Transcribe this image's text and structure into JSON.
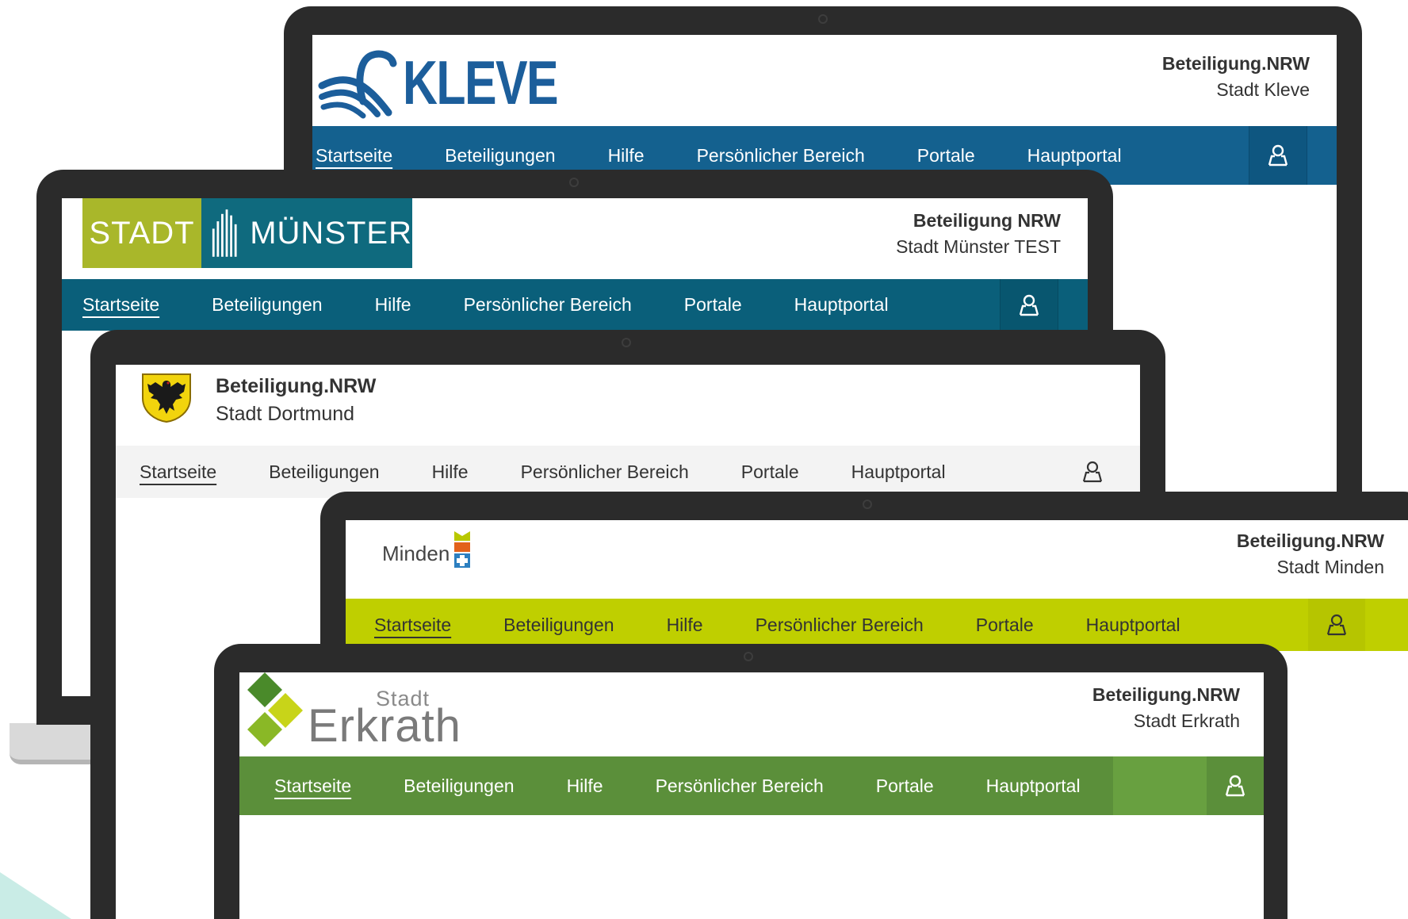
{
  "devices": [
    {
      "id": "kleve",
      "brand_title": "Beteiligung.NRW",
      "brand_subtitle": "Stadt Kleve",
      "logo_text": "KLEVE",
      "nav": [
        "Startseite",
        "Beteiligungen",
        "Hilfe",
        "Persönlicher Bereich",
        "Portale",
        "Hauptportal"
      ],
      "nav_color": "#14618f",
      "user_icon": "user-icon"
    },
    {
      "id": "muenster",
      "brand_title": "Beteiligung NRW",
      "brand_subtitle": "Stadt Münster TEST",
      "logo_text_left": "STADT",
      "logo_text_right": "MÜNSTER",
      "nav": [
        "Startseite",
        "Beteiligungen",
        "Hilfe",
        "Persönlicher Bereich",
        "Portale",
        "Hauptportal"
      ],
      "nav_color": "#0a5f7a",
      "logo_colors": {
        "left": "#a9b72a",
        "right": "#0f6a7e"
      },
      "user_icon": "user-icon"
    },
    {
      "id": "dortmund",
      "brand_title": "Beteiligung.NRW",
      "brand_subtitle": "Stadt Dortmund",
      "nav": [
        "Startseite",
        "Beteiligungen",
        "Hilfe",
        "Persönlicher Bereich",
        "Portale",
        "Hauptportal"
      ],
      "nav_color": "#f3f3f3",
      "user_icon": "user-icon"
    },
    {
      "id": "minden",
      "brand_title": "Beteiligung.NRW",
      "brand_subtitle": "Stadt Minden",
      "logo_text": "Minden",
      "nav": [
        "Startseite",
        "Beteiligungen",
        "Hilfe",
        "Persönlicher Bereich",
        "Portale",
        "Hauptportal"
      ],
      "nav_color": "#bfcf00",
      "user_icon": "user-icon"
    },
    {
      "id": "erkrath",
      "brand_title": "Beteiligung.NRW",
      "brand_subtitle": "Stadt Erkrath",
      "logo_text_small": "Stadt",
      "logo_text": "Erkrath",
      "nav": [
        "Startseite",
        "Beteiligungen",
        "Hilfe",
        "Persönlicher Bereich",
        "Portale",
        "Hauptportal"
      ],
      "nav_color": "#5b8f3a",
      "user_icon": "user-icon"
    }
  ]
}
